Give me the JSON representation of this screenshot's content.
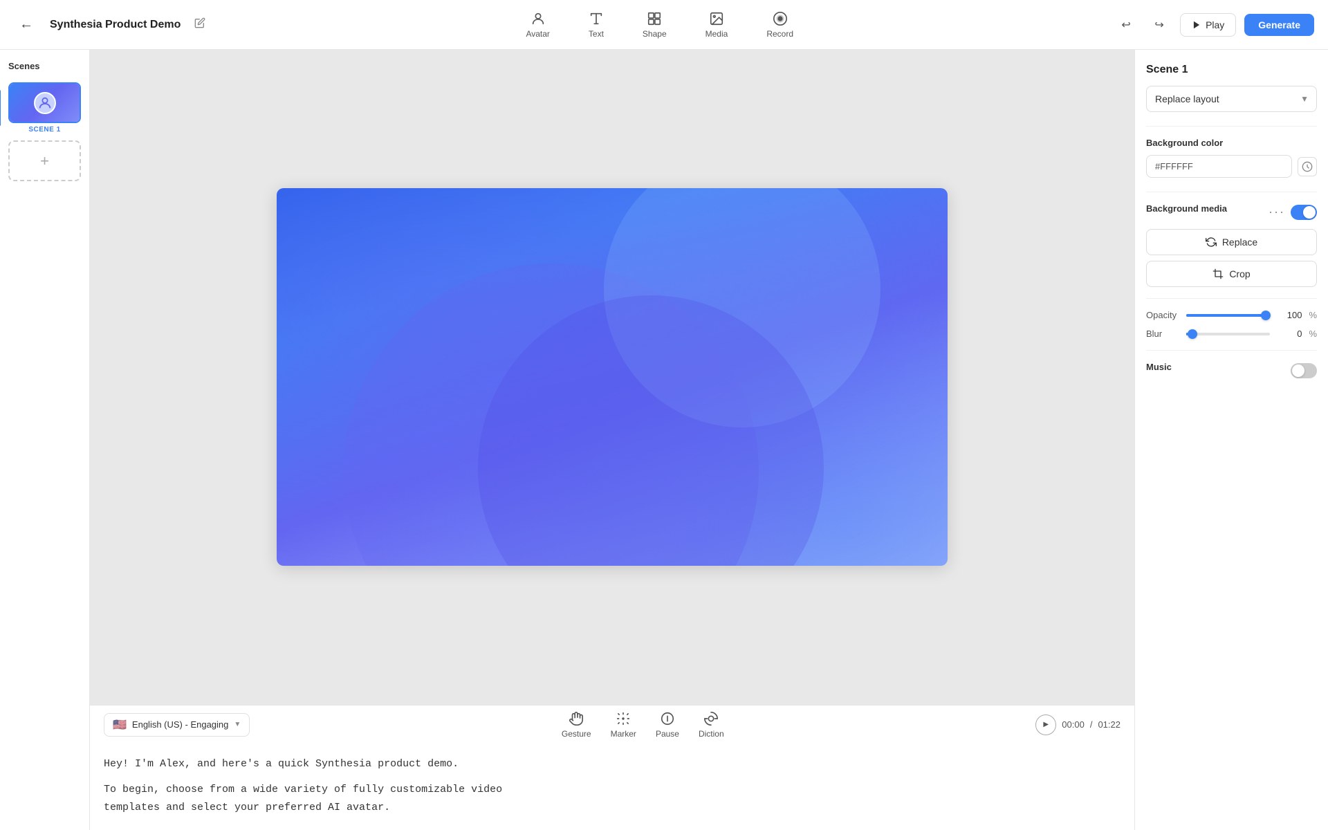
{
  "app": {
    "title": "Synthesia Product Demo",
    "edit_icon": "✏️"
  },
  "toolbar": {
    "back_label": "←",
    "undo_label": "↩",
    "redo_label": "↪",
    "play_label": "Play",
    "generate_label": "Generate",
    "tools": [
      {
        "id": "avatar",
        "label": "Avatar",
        "icon": "avatar"
      },
      {
        "id": "text",
        "label": "Text",
        "icon": "text"
      },
      {
        "id": "shape",
        "label": "Shape",
        "icon": "shape"
      },
      {
        "id": "media",
        "label": "Media",
        "icon": "media"
      },
      {
        "id": "record",
        "label": "Record",
        "icon": "record"
      }
    ]
  },
  "scenes": {
    "label": "Scenes",
    "items": [
      {
        "id": "scene1",
        "label": "SCENE 1",
        "active": true
      }
    ],
    "add_label": "+"
  },
  "right_panel": {
    "scene_title": "Scene 1",
    "replace_layout_label": "Replace layout",
    "bg_color_label": "Background color",
    "bg_color_value": "#FFFFFF",
    "bg_media_label": "Background media",
    "bg_media_enabled": true,
    "replace_label": "Replace",
    "crop_label": "Crop",
    "opacity_label": "Opacity",
    "opacity_value": "100",
    "opacity_unit": "%",
    "blur_label": "Blur",
    "blur_value": "0",
    "blur_unit": "%",
    "music_label": "Music",
    "music_enabled": false
  },
  "bottom": {
    "language": "English (US) - Engaging",
    "gesture_label": "Gesture",
    "marker_label": "Marker",
    "pause_label": "Pause",
    "diction_label": "Diction",
    "time_current": "00:00",
    "time_total": "01:22",
    "script_lines": [
      "Hey! I'm Alex, and here's a quick Synthesia product demo.",
      "",
      "To begin, choose from a wide variety of fully customizable video",
      "templates and select your preferred AI avatar."
    ]
  }
}
